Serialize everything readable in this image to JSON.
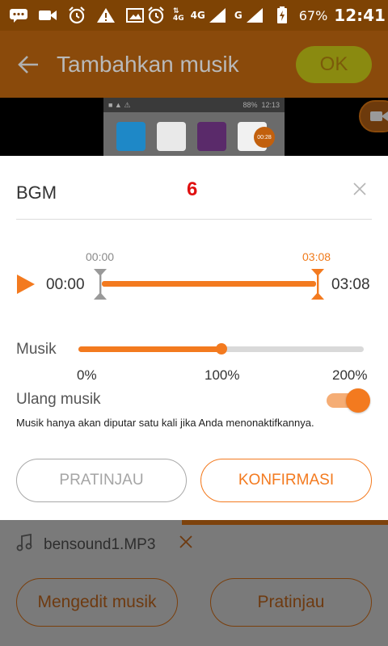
{
  "status_bar": {
    "battery_percent": "67%",
    "time": "12:41",
    "network_4g": "4G",
    "network_g": "G"
  },
  "app_bar": {
    "title": "Tambahkan musik",
    "ok_label": "OK"
  },
  "preview": {
    "inner_battery": "88%",
    "inner_time": "12:13",
    "inner_timer": "00:28"
  },
  "dialog": {
    "title": "BGM",
    "marker_number": "6",
    "trim": {
      "start_label": "00:00",
      "end_label": "03:08",
      "current_start": "00:00",
      "duration": "03:08",
      "start_fraction": 0,
      "end_fraction": 1
    },
    "music_label": "Musik",
    "volume": {
      "percent": 100,
      "ticks": [
        "0%",
        "100%",
        "200%"
      ]
    },
    "loop_label": "Ulang musik",
    "loop_on": true,
    "loop_note": "Musik hanya akan diputar satu kali jika Anda menonaktifkannya.",
    "preview_button": "PRATINJAU",
    "confirm_button": "KONFIRMASI"
  },
  "bottom": {
    "file_name": "bensound1.MP3",
    "edit_button": "Mengedit musik",
    "preview_button": "Pratinjau"
  },
  "colors": {
    "accent": "#f37a1f",
    "status_bar": "#7e4304",
    "marker_red": "#e01010"
  }
}
